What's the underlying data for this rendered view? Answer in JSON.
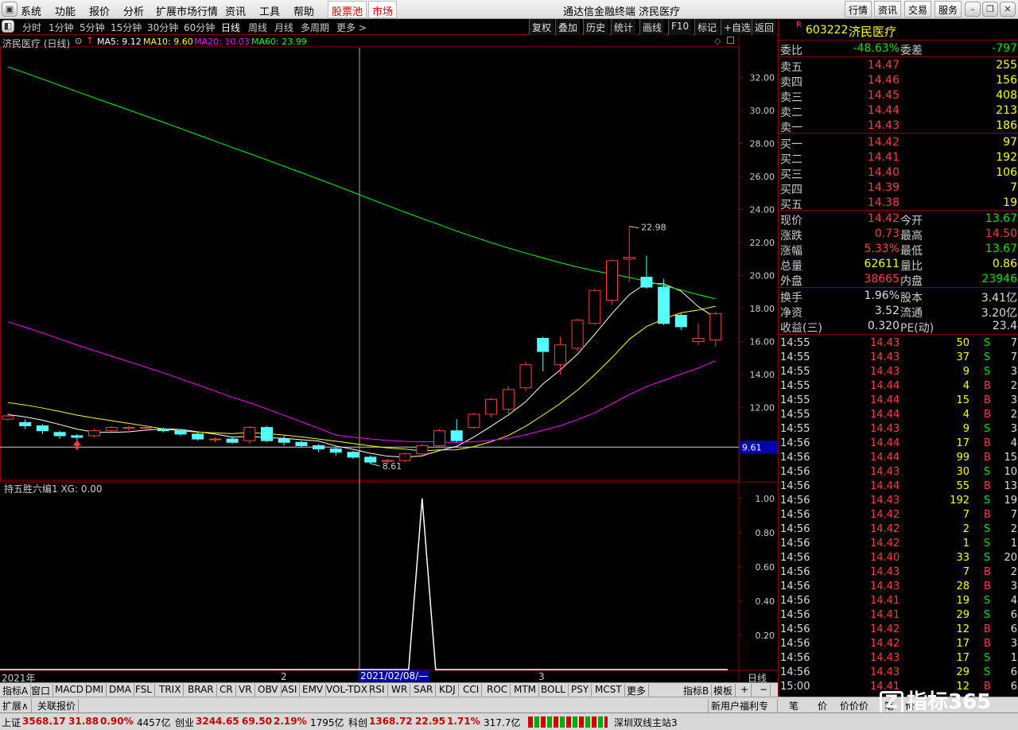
{
  "menu": {
    "items": [
      "系统",
      "功能",
      "报价",
      "分析",
      "扩展市场行情",
      "资讯",
      "工具",
      "帮助"
    ],
    "hot1": "股票池",
    "hot2": "市场",
    "title": "通达信金融终端 济民医疗",
    "right_buttons": [
      "行情",
      "资讯",
      "交易",
      "服务"
    ]
  },
  "period": {
    "items": [
      "分时",
      "1分钟",
      "5分钟",
      "15分钟",
      "30分钟",
      "60分钟",
      "日线",
      "周线",
      "月线",
      "多周期",
      "更多 >"
    ],
    "active": "日线",
    "tools": [
      "复权",
      "叠加",
      "历史",
      "统计",
      "画线",
      "F10",
      "标记",
      "+自选",
      "返回"
    ]
  },
  "chart": {
    "stock_label": "济民医疗 (日线)",
    "ma": [
      {
        "name": "MA5: 9.12",
        "color": "#ffffff"
      },
      {
        "name": "MA10: 9.60",
        "color": "#ffff00"
      },
      {
        "name": "MA20: 10.03",
        "color": "#ff00ff"
      },
      {
        "name": "MA60: 23.99",
        "color": "#00ff00"
      }
    ],
    "high_label": "22.98",
    "low_label": "8.61",
    "current_price_tag": "9.61",
    "indicator_label": "持五胜六编1  XG: 0.00",
    "date_axis": [
      "2021年",
      "2",
      "3"
    ],
    "cursor_date": "2021/02/08/—",
    "right_tab": "日线"
  },
  "chart_data": [
    {
      "type": "candlestick",
      "y_ticks": [
        12,
        14,
        16,
        18,
        20,
        22,
        24,
        26,
        28,
        30,
        32
      ],
      "ylim": [
        7.6,
        33.8
      ],
      "candles": [
        [
          11.3,
          11.5,
          11.2,
          11.7
        ],
        [
          11.1,
          10.9,
          10.7,
          11.3
        ],
        [
          10.9,
          10.6,
          10.4,
          11.0
        ],
        [
          10.5,
          10.3,
          10.1,
          10.6
        ],
        [
          10.3,
          10.2,
          10.0,
          10.4
        ],
        [
          10.3,
          10.6,
          10.2,
          10.7
        ],
        [
          10.6,
          10.8,
          10.5,
          10.9
        ],
        [
          10.8,
          10.8,
          10.6,
          10.9
        ],
        [
          10.8,
          10.8,
          10.7,
          10.9
        ],
        [
          10.7,
          10.6,
          10.5,
          10.8
        ],
        [
          10.6,
          10.4,
          10.3,
          10.7
        ],
        [
          10.4,
          10.1,
          10.0,
          10.5
        ],
        [
          10.1,
          10.1,
          9.9,
          10.2
        ],
        [
          10.1,
          9.9,
          9.8,
          10.2
        ],
        [
          10.0,
          10.8,
          9.8,
          10.9
        ],
        [
          10.8,
          10.0,
          9.9,
          10.9
        ],
        [
          10.1,
          9.9,
          9.7,
          10.3
        ],
        [
          9.9,
          9.7,
          9.6,
          10.0
        ],
        [
          9.7,
          9.5,
          9.3,
          9.8
        ],
        [
          9.5,
          9.3,
          9.1,
          9.6
        ],
        [
          9.3,
          9.0,
          8.9,
          9.4
        ],
        [
          9.0,
          8.7,
          8.61,
          9.1
        ],
        [
          8.8,
          8.8,
          8.61,
          8.9
        ],
        [
          8.8,
          9.2,
          8.7,
          9.3
        ],
        [
          9.2,
          9.7,
          9.1,
          9.8
        ],
        [
          9.7,
          10.6,
          9.6,
          10.7
        ],
        [
          10.6,
          10.0,
          9.9,
          11.3
        ],
        [
          10.8,
          11.6,
          10.7,
          11.7
        ],
        [
          11.6,
          12.5,
          11.4,
          12.6
        ],
        [
          11.9,
          13.1,
          11.5,
          13.3
        ],
        [
          13.2,
          14.6,
          13.0,
          14.8
        ],
        [
          16.2,
          15.4,
          14.2,
          16.3
        ],
        [
          14.6,
          15.8,
          14.0,
          16.3
        ],
        [
          15.6,
          17.3,
          15.4,
          17.4
        ],
        [
          17.1,
          19.1,
          17.0,
          19.2
        ],
        [
          18.5,
          20.9,
          18.2,
          21.0
        ],
        [
          21.0,
          21.1,
          19.6,
          22.98
        ],
        [
          19.9,
          19.3,
          19.2,
          21.2
        ],
        [
          19.3,
          17.1,
          17.0,
          19.8
        ],
        [
          17.6,
          16.9,
          16.7,
          17.7
        ],
        [
          16.0,
          16.2,
          15.8,
          17.1
        ],
        [
          16.1,
          17.7,
          15.7,
          17.8
        ]
      ],
      "series": [
        {
          "name": "MA5"
        },
        {
          "name": "MA10"
        },
        {
          "name": "MA20"
        },
        {
          "name": "MA60"
        }
      ]
    },
    {
      "type": "line",
      "y_ticks": [
        0.2,
        0.4,
        0.6,
        0.8,
        1.0
      ],
      "ylim": [
        0,
        1.05
      ],
      "values": [
        0,
        0,
        0,
        0,
        0,
        0,
        0,
        0,
        0,
        0,
        0,
        0,
        0,
        0,
        0,
        0,
        0,
        0,
        0,
        0,
        0,
        0,
        0,
        0,
        1,
        0,
        0,
        0,
        0,
        0,
        0,
        0,
        0,
        0,
        0,
        0,
        0,
        0,
        0,
        0,
        0,
        0
      ]
    }
  ],
  "quote": {
    "code": "603222",
    "name": "济民医疗",
    "wei_bi_label": "委比",
    "wei_bi": "-48.63%",
    "wei_cha_label": "委差",
    "wei_cha": "-797",
    "asks": [
      {
        "label": "卖五",
        "price": "14.47",
        "vol": "255"
      },
      {
        "label": "卖四",
        "price": "14.46",
        "vol": "156"
      },
      {
        "label": "卖三",
        "price": "14.45",
        "vol": "408"
      },
      {
        "label": "卖二",
        "price": "14.44",
        "vol": "213"
      },
      {
        "label": "卖一",
        "price": "14.43",
        "vol": "186"
      }
    ],
    "bids": [
      {
        "label": "买一",
        "price": "14.42",
        "vol": "97"
      },
      {
        "label": "买二",
        "price": "14.41",
        "vol": "192"
      },
      {
        "label": "买三",
        "price": "14.40",
        "vol": "106"
      },
      {
        "label": "买四",
        "price": "14.39",
        "vol": "7"
      },
      {
        "label": "买五",
        "price": "14.38",
        "vol": "19"
      }
    ],
    "stats": [
      {
        "l1": "现价",
        "v1": "14.42",
        "c1": "red",
        "l2": "今开",
        "v2": "13.67",
        "c2": "green"
      },
      {
        "l1": "涨跌",
        "v1": "0.73",
        "c1": "red",
        "l2": "最高",
        "v2": "14.50",
        "c2": "red"
      },
      {
        "l1": "涨幅",
        "v1": "5.33%",
        "c1": "red",
        "l2": "最低",
        "v2": "13.67",
        "c2": "green"
      },
      {
        "l1": "总量",
        "v1": "62611",
        "c1": "yel",
        "l2": "量比",
        "v2": "0.86",
        "c2": "yel"
      },
      {
        "l1": "外盘",
        "v1": "38665",
        "c1": "red",
        "l2": "内盘",
        "v2": "23946",
        "c2": "green"
      }
    ],
    "stats2": [
      {
        "l1": "换手",
        "v1": "1.96%",
        "l2": "股本",
        "v2": "3.41亿"
      },
      {
        "l1": "净资",
        "v1": "3.52",
        "l2": "流通",
        "v2": "3.20亿"
      },
      {
        "l1": "收益(三)",
        "v1": "0.320",
        "l2": "PE(动)",
        "v2": "23.4"
      }
    ]
  },
  "ticks": [
    [
      "14:55",
      "14.43",
      "50",
      "S",
      "7"
    ],
    [
      "14:55",
      "14.43",
      "37",
      "S",
      "7"
    ],
    [
      "14:55",
      "14.43",
      "9",
      "S",
      "3"
    ],
    [
      "14:55",
      "14.44",
      "4",
      "B",
      "2"
    ],
    [
      "14:55",
      "14.44",
      "15",
      "B",
      "3"
    ],
    [
      "14:55",
      "14.44",
      "4",
      "B",
      "2"
    ],
    [
      "14:55",
      "14.43",
      "9",
      "S",
      "3"
    ],
    [
      "14:56",
      "14.44",
      "17",
      "B",
      "4"
    ],
    [
      "14:56",
      "14.44",
      "99",
      "B",
      "15"
    ],
    [
      "14:56",
      "14.43",
      "30",
      "S",
      "10"
    ],
    [
      "14:56",
      "14.44",
      "55",
      "B",
      "13"
    ],
    [
      "14:56",
      "14.43",
      "192",
      "S",
      "19"
    ],
    [
      "14:56",
      "14.42",
      "7",
      "B",
      "7"
    ],
    [
      "14:56",
      "14.42",
      "2",
      "S",
      "2"
    ],
    [
      "14:56",
      "14.42",
      "1",
      "S",
      "1"
    ],
    [
      "14:56",
      "14.40",
      "33",
      "S",
      "20"
    ],
    [
      "14:56",
      "14.43",
      "7",
      "B",
      "2"
    ],
    [
      "14:56",
      "14.43",
      "28",
      "B",
      "3"
    ],
    [
      "14:56",
      "14.41",
      "19",
      "S",
      "4"
    ],
    [
      "14:56",
      "14.41",
      "29",
      "S",
      "6"
    ],
    [
      "14:56",
      "14.42",
      "12",
      "B",
      "6"
    ],
    [
      "14:56",
      "14.42",
      "17",
      "B",
      "3"
    ],
    [
      "14:56",
      "14.43",
      "17",
      "S",
      "1"
    ],
    [
      "14:56",
      "14.43",
      "29",
      "S",
      "6"
    ],
    [
      "15:00",
      "14.41",
      "12",
      "B",
      "6"
    ]
  ],
  "indicator_tabs": [
    "指标A",
    "窗口",
    "MACD",
    "DMI",
    "DMA",
    "FSL",
    "TRIX",
    "BRAR",
    "CR",
    "VR",
    "OBV",
    "ASI",
    "EMV",
    "VOL-TDX",
    "RSI",
    "WR",
    "SAR",
    "KDJ",
    "CCI",
    "ROC",
    "MTM",
    "BOLL",
    "PSY",
    "MCST",
    "更多",
    "指标B",
    "模板",
    "+",
    "−"
  ],
  "ext_tabs": [
    "扩展∧",
    "关联报价"
  ],
  "right_tabs": {
    "promo": "新用户福利专享",
    "tabs": [
      "笔",
      "价",
      "价价价",
      "笔",
      "价"
    ]
  },
  "status": [
    {
      "name": "上证",
      "v": "3568.17",
      "c": "31.88",
      "p": "0.90%",
      "a": "4457亿"
    },
    {
      "name": "创业",
      "v": "3244.65",
      "c": "69.50",
      "p": "2.19%",
      "a": "1795亿"
    },
    {
      "name": "科创",
      "v": "1368.72",
      "c": "22.95",
      "p": "1.71%",
      "a": "317.7亿"
    }
  ],
  "server": "深圳双线主站3",
  "logo": "指标365",
  "colors": {
    "up": "#ff3c3c",
    "down": "#54ffff",
    "ma5": "#ffffff",
    "ma10": "#ffff00",
    "ma20": "#ff00ff",
    "ma60": "#00ff00",
    "frame": "#800000"
  }
}
